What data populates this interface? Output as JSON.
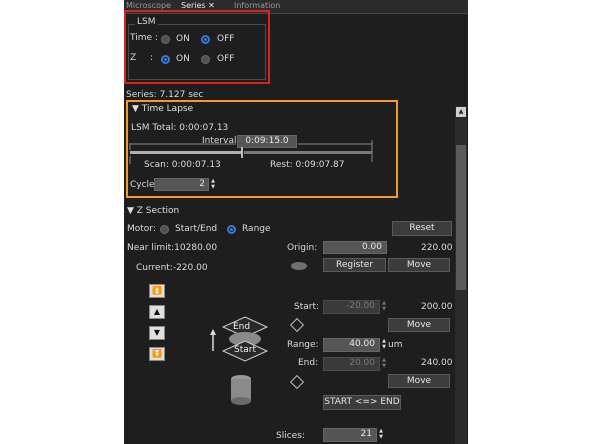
{
  "tabs": [
    {
      "label": "Microscope"
    },
    {
      "label": "Series ✕"
    },
    {
      "label": "Information"
    }
  ],
  "lsm": {
    "title": "LSM",
    "time_label": "Time :",
    "z_label": "Z",
    "z_colon": ":",
    "on": "ON",
    "off": "OFF",
    "time_selected": "OFF",
    "z_selected": "ON"
  },
  "series_time": "Series: 7.127 sec",
  "time_lapse": {
    "header": "▼ Time Lapse",
    "lsm_total": "LSM Total:  0:00:07.13",
    "interval_label": "Interval:",
    "interval_value": "0:09:15.0",
    "scan": "Scan:  0:00:07.13",
    "rest": "Rest:  0:09:07.87",
    "cycle_label": "Cycle:",
    "cycle_value": "2"
  },
  "z_section": {
    "header": "▼ Z Section",
    "motor_label": "Motor:",
    "start_end": "Start/End",
    "range": "Range",
    "motor_selected": "Range",
    "reset": "Reset",
    "near_limit": "Near limit:10280.00",
    "current": "Current:-220.00",
    "origin_label": "Origin:",
    "origin_value": "0.00",
    "origin_right": "220.00",
    "register": "Register",
    "move": "Move",
    "start_label": "Start:",
    "start_value": "-20.00",
    "start_right": "200.00",
    "range_label": "Range:",
    "range_value": "40.00",
    "range_unit": "um",
    "end_label": "End:",
    "end_value": "20.00",
    "end_right": "240.00",
    "swap": "START <=> END",
    "slices_label": "Slices:",
    "slices_value": "21",
    "diagram_end": "End",
    "diagram_start": "Start"
  },
  "colors": {
    "highlight_red": "#e02020",
    "highlight_orange": "#f39a2a",
    "radio_selected": "#3a7bd5"
  }
}
